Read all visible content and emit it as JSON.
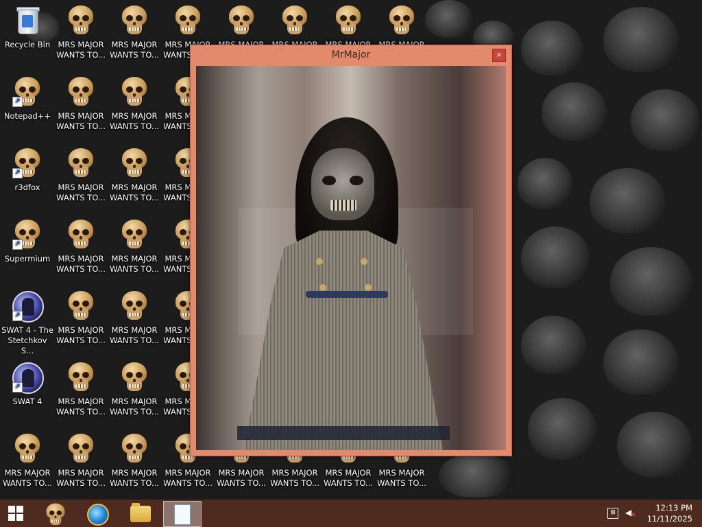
{
  "desktop": {
    "icons": [
      {
        "label": "Recycle Bin"
      },
      {
        "label": "Notepad++"
      },
      {
        "label": "r3dfox"
      },
      {
        "label": "Supermium"
      },
      {
        "label": "SWAT 4 - The Stetchkov S..."
      },
      {
        "label": "SWAT 4"
      },
      {
        "label": "MRS MAJOR WANTS TO..."
      }
    ],
    "mrs_major_label": "MRS MAJOR WANTS TO..."
  },
  "window": {
    "title": "MrMajor",
    "close_label": "×",
    "frame_color": "#e48a6c"
  },
  "taskbar": {
    "color": "#4f2a1e",
    "clock_time": "12:13 PM",
    "clock_date": "11/11/2025"
  }
}
